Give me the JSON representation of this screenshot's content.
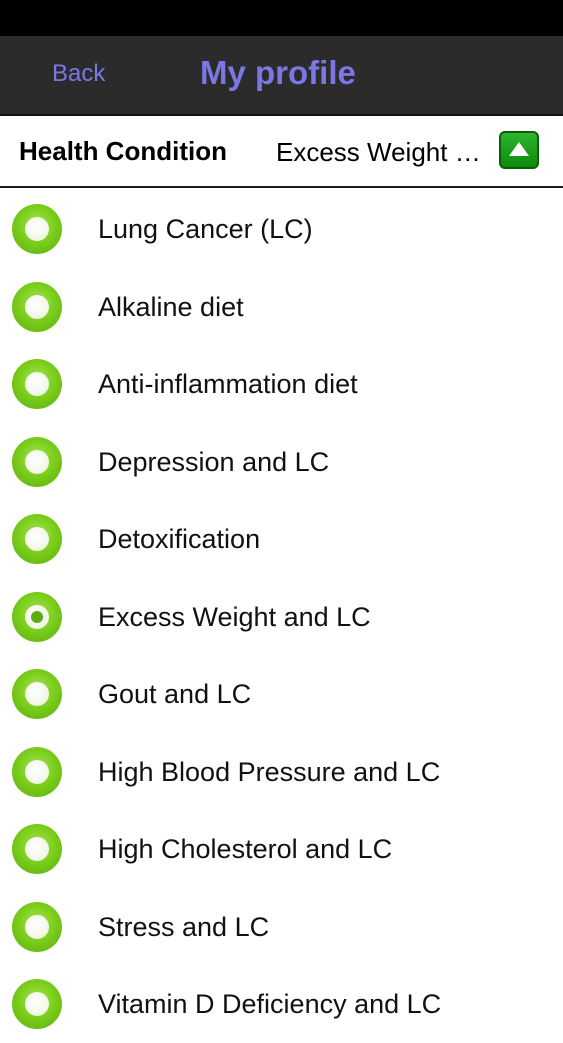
{
  "nav": {
    "back_label": "Back",
    "title": "My profile"
  },
  "condition": {
    "label": "Health Condition",
    "value": "Excess Weight and LC"
  },
  "colors": {
    "nav_accent": "#7b78e6",
    "radio_green": "#7ccf1c",
    "button_green": "#1a9e1a"
  },
  "icons": {
    "collapse": "triangle-up-icon",
    "radio": "radio-icon"
  },
  "items": [
    {
      "label": "Lung Cancer (LC)",
      "selected": false
    },
    {
      "label": "Alkaline diet",
      "selected": false
    },
    {
      "label": "Anti-inflammation diet",
      "selected": false
    },
    {
      "label": "Depression and LC",
      "selected": false
    },
    {
      "label": "Detoxification",
      "selected": false
    },
    {
      "label": "Excess Weight and LC",
      "selected": true
    },
    {
      "label": "Gout and LC",
      "selected": false
    },
    {
      "label": "High Blood Pressure and LC",
      "selected": false
    },
    {
      "label": "High Cholesterol and LC",
      "selected": false
    },
    {
      "label": "Stress and LC",
      "selected": false
    },
    {
      "label": "Vitamin D Deficiency and LC",
      "selected": false
    }
  ]
}
